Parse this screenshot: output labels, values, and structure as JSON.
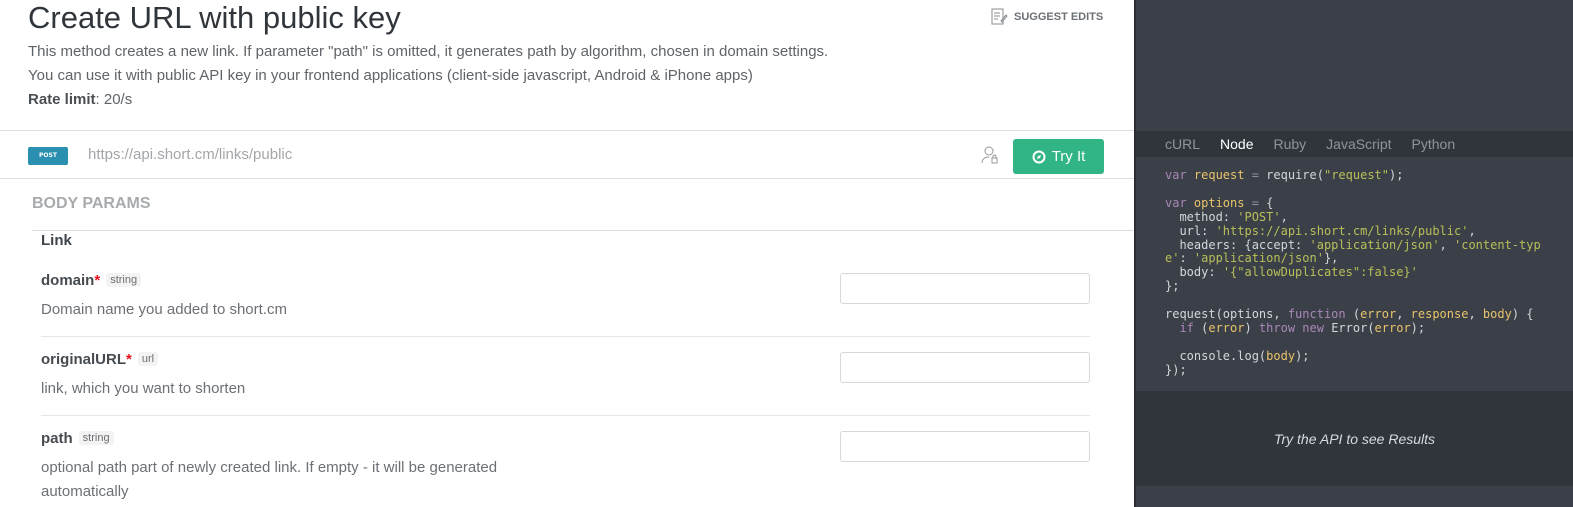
{
  "page": {
    "title": "Create URL with public key",
    "description_lines": [
      "This method creates a new link. If parameter \"path\" is omitted, it generates path by algorithm, chosen in domain settings.",
      "You can use it with public API key in your frontend applications (client-side javascript, Android & iPhone apps)"
    ],
    "rate_limit_label": "Rate limit",
    "rate_limit_value": ": 20/s",
    "suggest_edits": "SUGGEST EDITS"
  },
  "endpoint": {
    "method": "POST",
    "url": "https://api.short.cm/links/public",
    "try_it": "Try It"
  },
  "body_params": {
    "heading": "BODY PARAMS",
    "group": "Link",
    "params": [
      {
        "name": "domain",
        "required": "*",
        "type": "string",
        "description": "Domain name you added to short.cm",
        "value": ""
      },
      {
        "name": "originalURL",
        "required": "*",
        "type": "url",
        "description": "link, which you want to shorten",
        "value": ""
      },
      {
        "name": "path",
        "required": "",
        "type": "string",
        "description": "optional path part of newly created link. If empty - it will be generated automatically",
        "value": ""
      }
    ]
  },
  "code_panel": {
    "tabs": [
      "cURL",
      "Node",
      "Ruby",
      "JavaScript",
      "Python"
    ],
    "active_tab": "Node",
    "lines": [
      [
        [
          "kw",
          "var "
        ],
        [
          "var",
          "request"
        ],
        [
          "op",
          " = "
        ],
        [
          "pl",
          "require("
        ],
        [
          "str",
          "\"request\""
        ],
        [
          "pl",
          ");"
        ]
      ],
      [],
      [
        [
          "kw",
          "var "
        ],
        [
          "var",
          "options"
        ],
        [
          "op",
          " = "
        ],
        [
          "pl",
          "{"
        ]
      ],
      [
        [
          "pl",
          "  method: "
        ],
        [
          "str",
          "'POST'"
        ],
        [
          "pl",
          ","
        ]
      ],
      [
        [
          "pl",
          "  url: "
        ],
        [
          "str",
          "'https://api.short.cm/links/public'"
        ],
        [
          "pl",
          ","
        ]
      ],
      [
        [
          "pl",
          "  headers: {accept: "
        ],
        [
          "str",
          "'application/json'"
        ],
        [
          "pl",
          ", "
        ],
        [
          "str",
          "'content-type'"
        ],
        [
          "pl",
          ": "
        ],
        [
          "str",
          "'application/json'"
        ],
        [
          "pl",
          "},"
        ]
      ],
      [
        [
          "pl",
          "  body: "
        ],
        [
          "str",
          "'{\"allowDuplicates\":false}'"
        ]
      ],
      [
        [
          "pl",
          "};"
        ]
      ],
      [],
      [
        [
          "pl",
          "request(options, "
        ],
        [
          "kw",
          "function"
        ],
        [
          "pl",
          " ("
        ],
        [
          "var",
          "error"
        ],
        [
          "pl",
          ", "
        ],
        [
          "var",
          "response"
        ],
        [
          "pl",
          ", "
        ],
        [
          "var",
          "body"
        ],
        [
          "pl",
          ") {"
        ]
      ],
      [
        [
          "kw",
          "  if"
        ],
        [
          "pl",
          " ("
        ],
        [
          "var",
          "error"
        ],
        [
          "pl",
          ") "
        ],
        [
          "kw",
          "throw new"
        ],
        [
          "pl",
          " Error("
        ],
        [
          "var",
          "error"
        ],
        [
          "pl",
          ");"
        ]
      ],
      [],
      [
        [
          "pl",
          "  console.log("
        ],
        [
          "var",
          "body"
        ],
        [
          "pl",
          ");"
        ]
      ],
      [
        [
          "pl",
          "});"
        ]
      ]
    ],
    "results_placeholder": "Try the API to see Results"
  }
}
